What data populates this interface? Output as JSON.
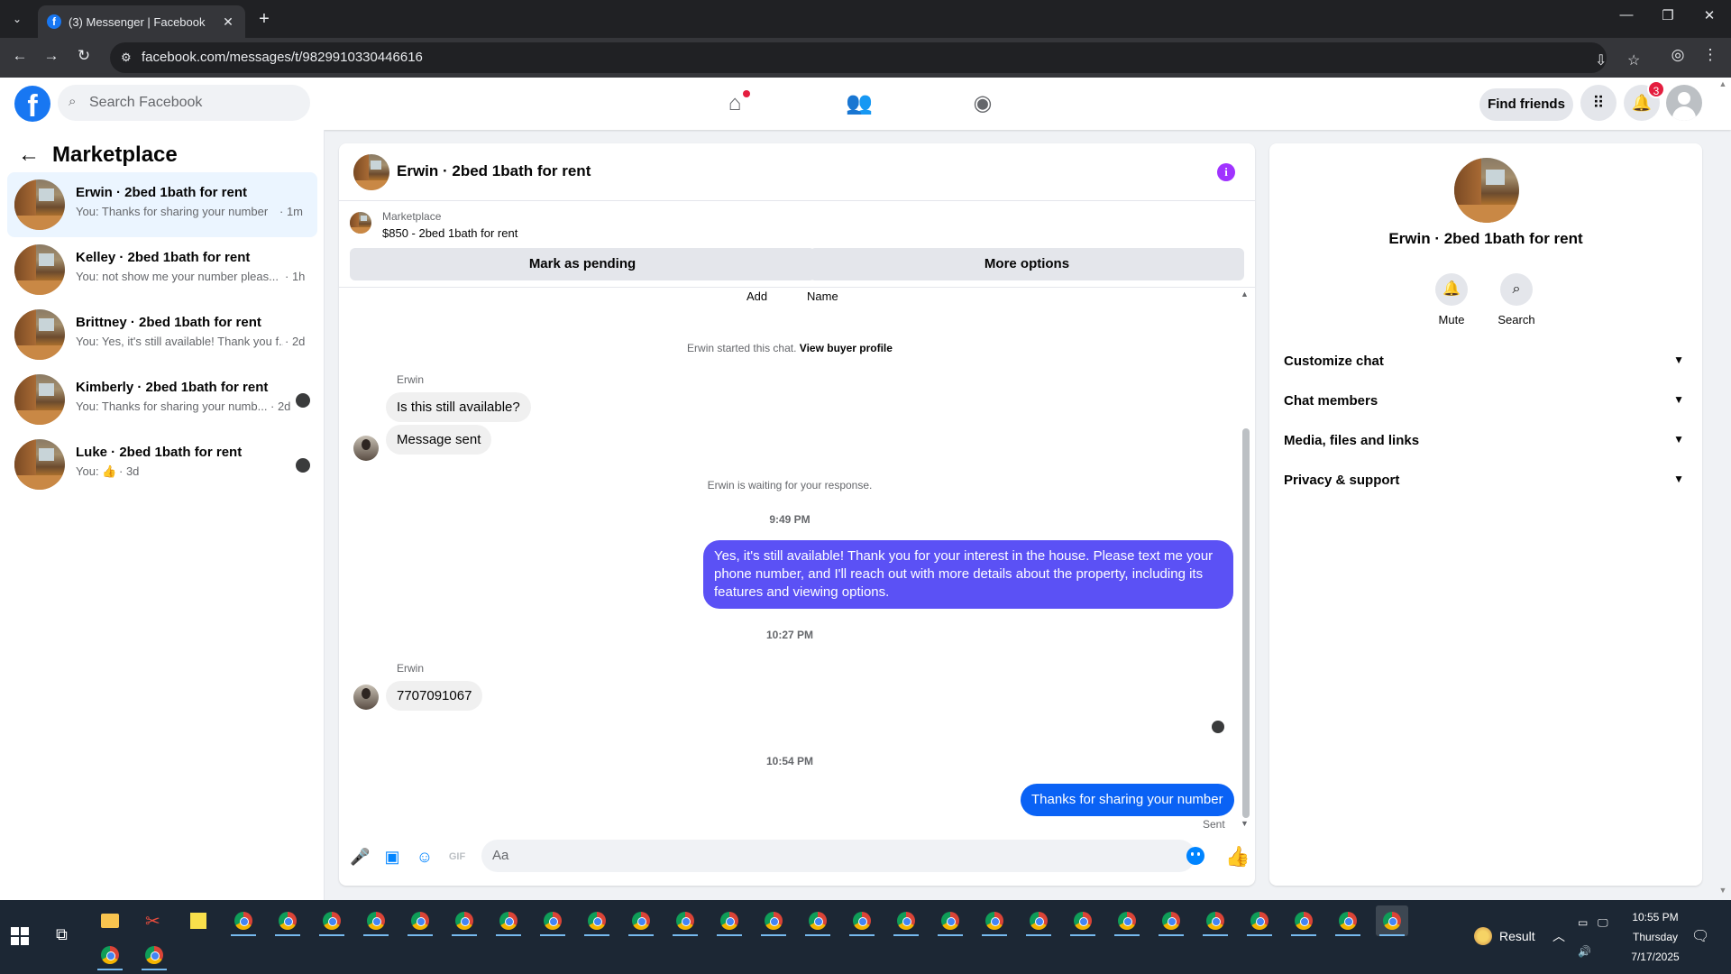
{
  "browser": {
    "tab_title": "(3) Messenger | Facebook",
    "url": "facebook.com/messages/t/9829910330446616",
    "icons": {
      "tab_list": "chevron-down-icon",
      "favicon": "facebook-icon",
      "close_tab": "close-icon",
      "new_tab": "plus-icon",
      "back": "arrow-left-icon",
      "forward": "arrow-right-icon",
      "reload": "reload-icon",
      "site_info": "tune-icon",
      "install": "install-icon",
      "bookmark": "star-icon",
      "profile": "profile-icon",
      "menu": "kebab-menu-icon"
    }
  },
  "fb_header": {
    "logo": "f",
    "search_placeholder": "Search Facebook",
    "find_friends": "Find friends",
    "notification_count": "3",
    "brand_color": "#1877f2"
  },
  "sidebar": {
    "title": "Marketplace",
    "conversations": [
      {
        "name": "Erwin · 2bed 1bath for rent",
        "snippet": "You: Thanks for sharing your number",
        "time": "· 1m",
        "active": true
      },
      {
        "name": "Kelley · 2bed 1bath for rent",
        "snippet": "You: not show me your number pleas...",
        "time": "· 1h"
      },
      {
        "name": "Brittney · 2bed 1bath for rent",
        "snippet": "You: Yes, it's still available! Thank you f...",
        "time": "· 2d"
      },
      {
        "name": "Kimberly · 2bed 1bath for rent",
        "snippet": "You: Thanks for sharing your numb...",
        "time": "· 2d"
      },
      {
        "name": "Luke · 2bed 1bath for rent",
        "snippet": "You: 👍",
        "time": "· 3d"
      }
    ]
  },
  "chat": {
    "title": "Erwin · 2bed 1bath for rent",
    "listing_category": "Marketplace",
    "listing_price": "$850 - 2bed 1bath for rent",
    "mark_pending": "Mark as pending",
    "more_options": "More options",
    "col_add": "Add",
    "col_name": "Name",
    "started_note": "Erwin started this chat.",
    "view_buyer_profile": "View buyer profile",
    "sender_1": "Erwin",
    "msg_1": "Is this still available?",
    "msg_2": "Message sent",
    "waiting_note": "Erwin is waiting for your response.",
    "time_1": "9:49 PM",
    "msg_3": "Yes, it's still available! Thank you for your interest in the house. Please text me your phone number, and I'll reach out with more details about the property, including its features and viewing options.",
    "time_2": "10:27 PM",
    "sender_2": "Erwin",
    "msg_4": "7707091067",
    "time_3": "10:54 PM",
    "msg_5": "Thanks for sharing your number",
    "sent_label": "Sent",
    "composer_placeholder": "Aa",
    "outgoing_color_1": "#5b51f5",
    "outgoing_color_2": "#0a62f5",
    "composer_icons": [
      "microphone-icon",
      "image-icon",
      "sticker-icon",
      "gif-icon",
      "emoji-icon",
      "thumbs-up-icon"
    ]
  },
  "info_pane": {
    "name": "Erwin · 2bed 1bath for rent",
    "mute": "Mute",
    "search": "Search",
    "sections": [
      "Customize chat",
      "Chat members",
      "Media, files and links",
      "Privacy & support"
    ]
  },
  "taskbar": {
    "weather_label": "Result",
    "time": "10:55 PM",
    "day": "Thursday",
    "date": "7/17/2025"
  }
}
